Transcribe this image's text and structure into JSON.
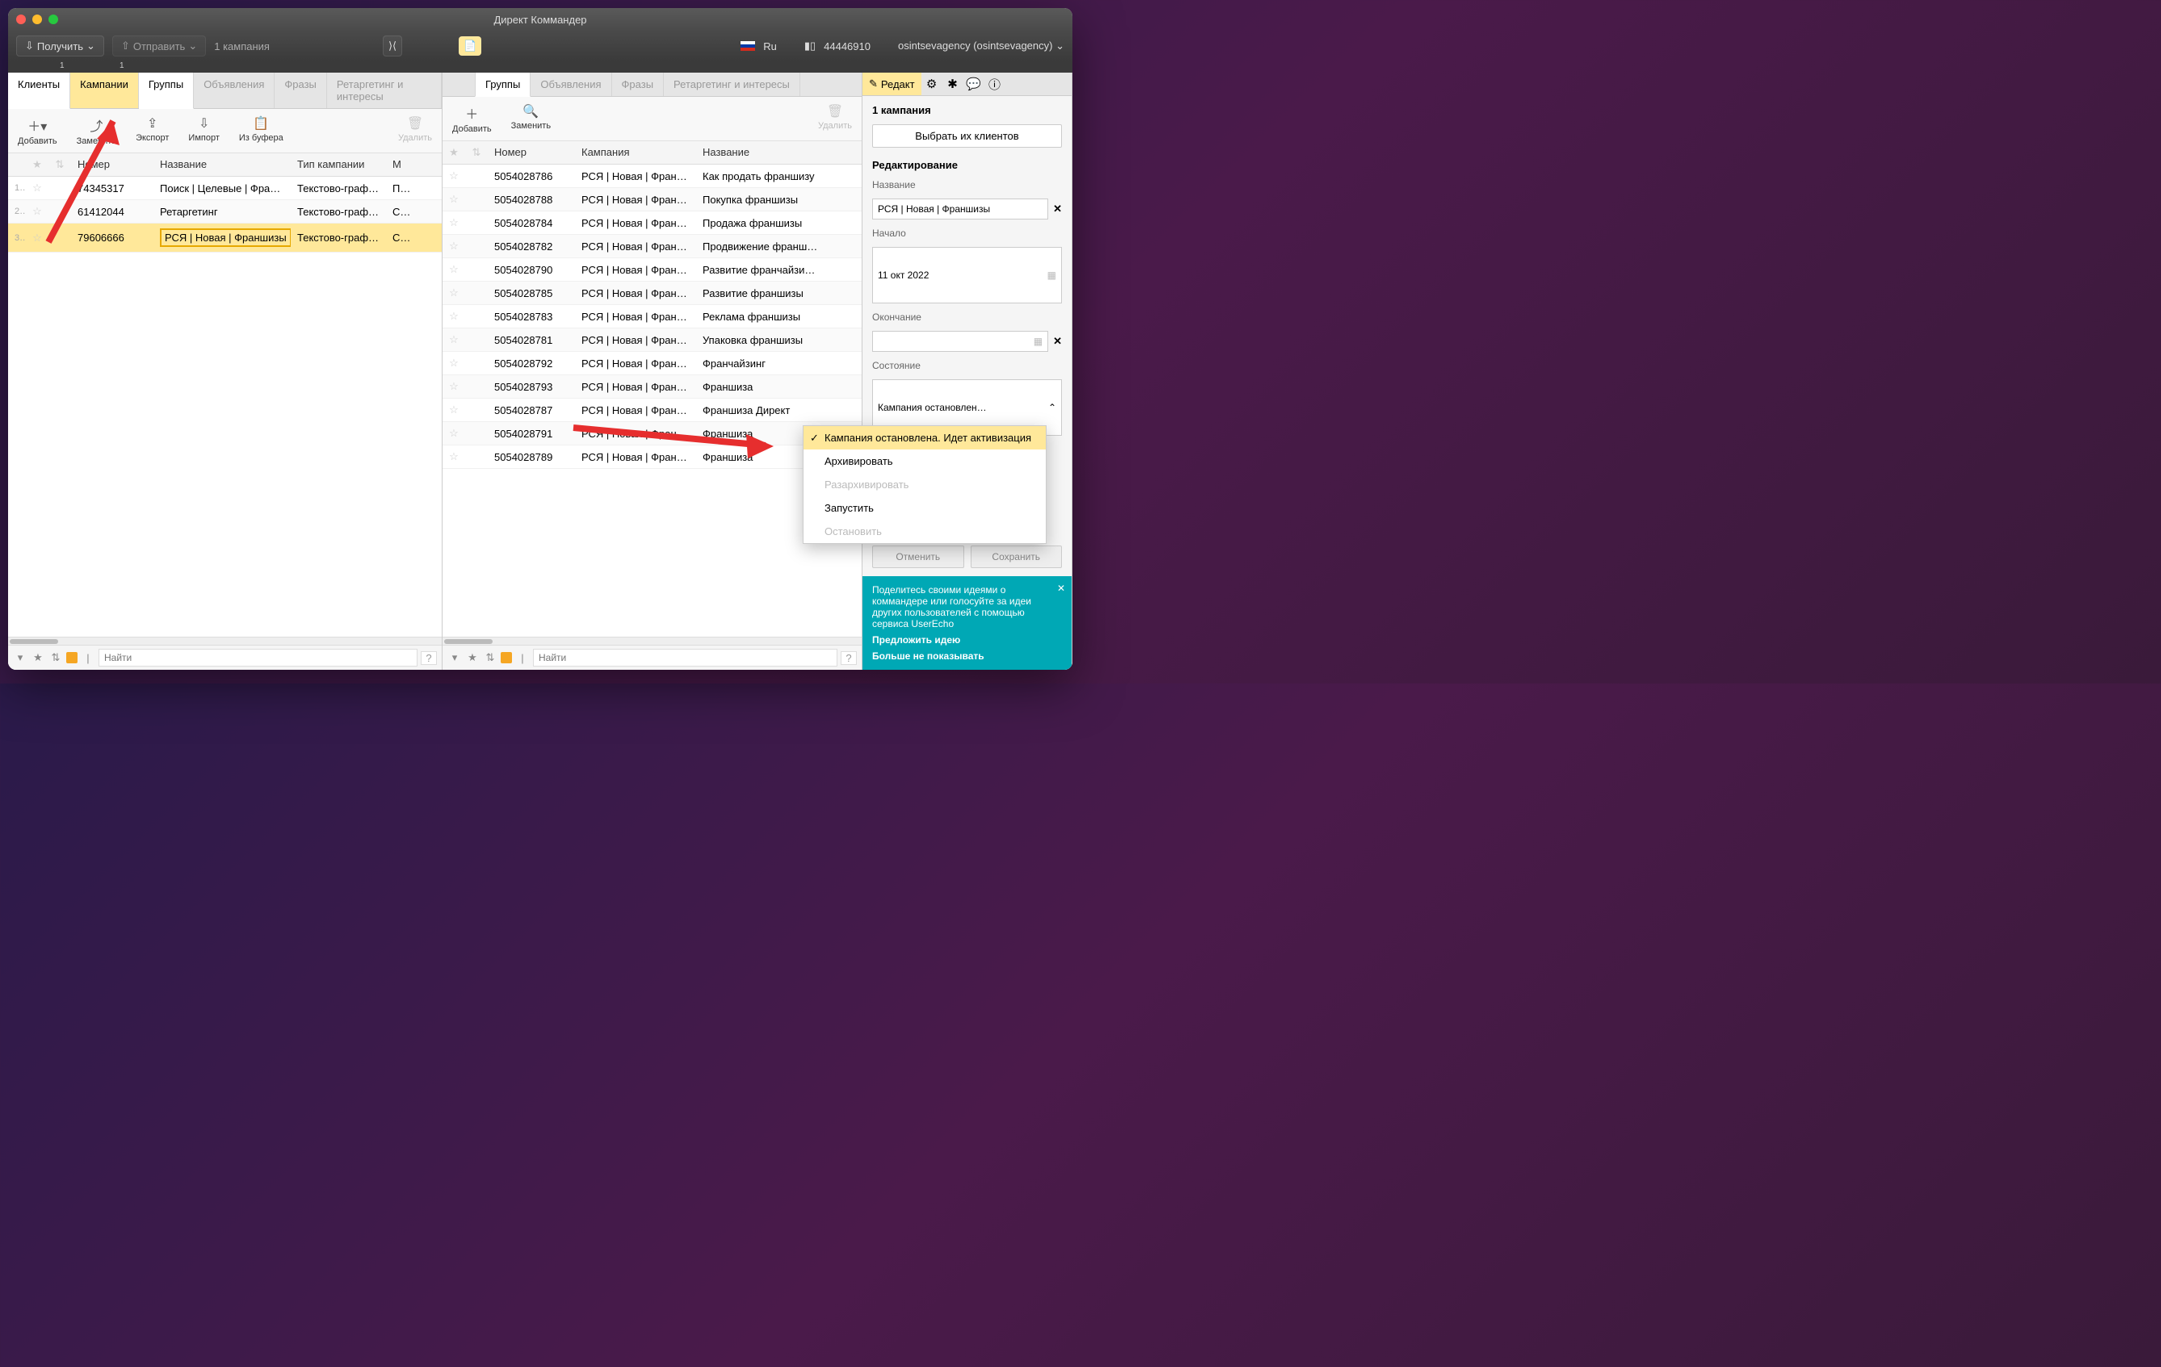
{
  "titlebar": {
    "title": "Директ Коммандер"
  },
  "toolbar": {
    "get": "Получить",
    "send": "Отправить",
    "status": "1 кампания",
    "lang": "Ru",
    "points": "44446910",
    "user": "osintsevagency (osintsevagency)"
  },
  "leftPane": {
    "tabs": {
      "clients": "Клиенты",
      "campaigns": "Кампании",
      "groups": "Группы",
      "ads": "Объявления",
      "phrases": "Фразы",
      "retarget": "Ретаргетинг и интересы"
    },
    "badges": {
      "clients": "1",
      "campaigns": "1"
    },
    "actions": {
      "add": "Добавить",
      "replace": "Заменить",
      "export": "Экспорт",
      "import": "Импорт",
      "frombuf": "Из буфера",
      "delete": "Удалить"
    },
    "headers": {
      "num": "Номер",
      "name": "Название",
      "type": "Тип кампании",
      "m": "М"
    },
    "rows": [
      {
        "idx": "1",
        "num": "74345317",
        "name": "Поиск | Целевые | Фран…",
        "type": "Текстово-граф…",
        "m": "Пс"
      },
      {
        "idx": "2",
        "num": "61412044",
        "name": "Ретаргетинг",
        "type": "Текстово-граф…",
        "m": "Сс"
      },
      {
        "idx": "3",
        "num": "79606666",
        "name": "РСЯ | Новая | Франшизы",
        "type": "Текстово-граф…",
        "m": "Сс"
      }
    ],
    "search": "Найти"
  },
  "midPane": {
    "tabs": {
      "groups": "Группы",
      "ads": "Объявления",
      "phrases": "Фразы",
      "retarget": "Ретаргетинг и интересы"
    },
    "actions": {
      "add": "Добавить",
      "replace": "Заменить",
      "delete": "Удалить"
    },
    "headers": {
      "num": "Номер",
      "camp": "Кампания",
      "name": "Название"
    },
    "rows": [
      {
        "num": "5054028786",
        "camp": "РСЯ | Новая | Франш…",
        "name": "Как продать франшизу"
      },
      {
        "num": "5054028788",
        "camp": "РСЯ | Новая | Франш…",
        "name": "Покупка франшизы"
      },
      {
        "num": "5054028784",
        "camp": "РСЯ | Новая | Франш…",
        "name": "Продажа франшизы"
      },
      {
        "num": "5054028782",
        "camp": "РСЯ | Новая | Франш…",
        "name": "Продвижение франшизы"
      },
      {
        "num": "5054028790",
        "camp": "РСЯ | Новая | Франш…",
        "name": "Развитие франчайзинга"
      },
      {
        "num": "5054028785",
        "camp": "РСЯ | Новая | Франш…",
        "name": "Развитие франшизы"
      },
      {
        "num": "5054028783",
        "camp": "РСЯ | Новая | Франш…",
        "name": "Реклама франшизы"
      },
      {
        "num": "5054028781",
        "camp": "РСЯ | Новая | Франш…",
        "name": "Упаковка франшизы"
      },
      {
        "num": "5054028792",
        "camp": "РСЯ | Новая | Франш…",
        "name": "Франчайзинг"
      },
      {
        "num": "5054028793",
        "camp": "РСЯ | Новая | Франш…",
        "name": "Франшиза"
      },
      {
        "num": "5054028787",
        "camp": "РСЯ | Новая | Франш…",
        "name": "Франшиза Директ"
      },
      {
        "num": "5054028791",
        "camp": "РСЯ | Новая | Франш…",
        "name": "Франшиза"
      },
      {
        "num": "5054028789",
        "camp": "РСЯ | Новая | Франш…",
        "name": "Франшиза"
      }
    ],
    "search": "Найти"
  },
  "rightPane": {
    "tab": "Редакт",
    "count": "1 кампания",
    "chooseClients": "Выбрать их клиентов",
    "editTitle": "Редактирование",
    "nameLabel": "Название",
    "nameValue": "РСЯ | Новая | Франшизы",
    "startLabel": "Начало",
    "startValue": "11 окт 2022",
    "endLabel": "Окончание",
    "endValue": "",
    "stateLabel": "Состояние",
    "stateValue": "Кампания остановлен…",
    "cancel": "Отменить",
    "save": "Сохранить",
    "dropdown": {
      "opt1": "Кампания остановлена. Идет активизация",
      "opt2": "Архивировать",
      "opt3": "Разархивировать",
      "opt4": "Запустить",
      "opt5": "Остановить"
    },
    "promo": {
      "text": "Поделитесь своими идеями о коммандере или голосуйте за идеи других пользователей с помощью сервиса UserEcho",
      "link1": "Предложить идею",
      "link2": "Больше не показывать"
    }
  }
}
